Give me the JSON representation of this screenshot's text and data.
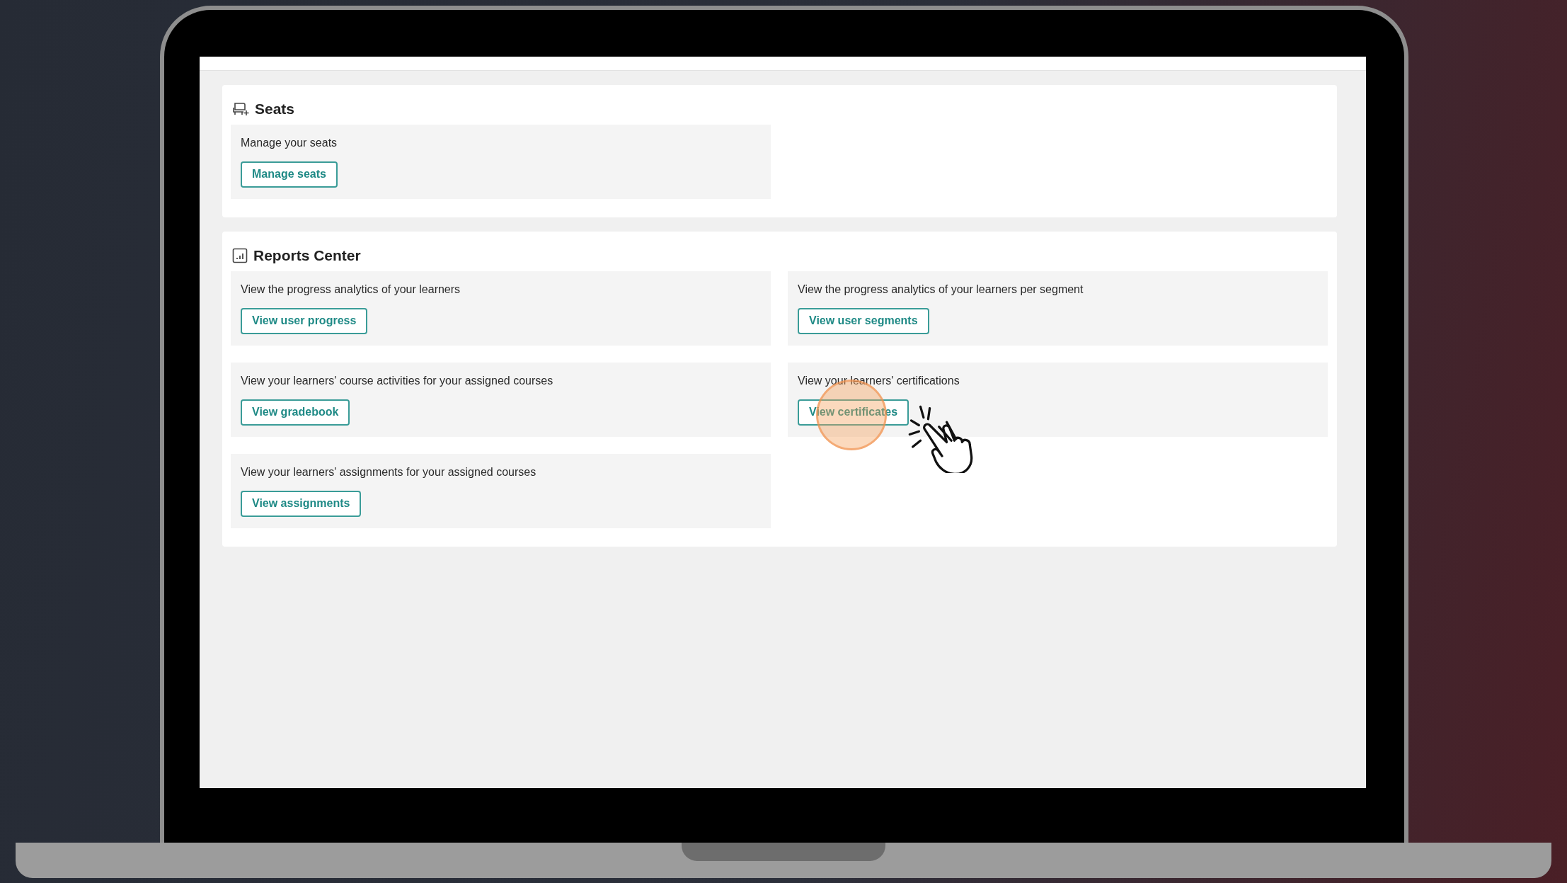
{
  "sections": [
    {
      "title": "Seats",
      "kind": "seat",
      "items": [
        {
          "description": "Manage your seats",
          "button": "Manage seats",
          "clicked": false
        }
      ]
    },
    {
      "title": "Reports Center",
      "kind": "chart",
      "items": [
        {
          "description": "View the progress analytics of your learners",
          "button": "View user progress",
          "clicked": false
        },
        {
          "description": "View the progress analytics of your learners per segment",
          "button": "View user segments",
          "clicked": false
        },
        {
          "description": "View your learners' course activities for your assigned courses",
          "button": "View gradebook",
          "clicked": false
        },
        {
          "description": "View your learners' certifications",
          "button": "View certificates",
          "clicked": true
        },
        {
          "description": "View your learners' assignments for your assigned courses",
          "button": "View assignments",
          "clicked": false
        }
      ]
    }
  ]
}
